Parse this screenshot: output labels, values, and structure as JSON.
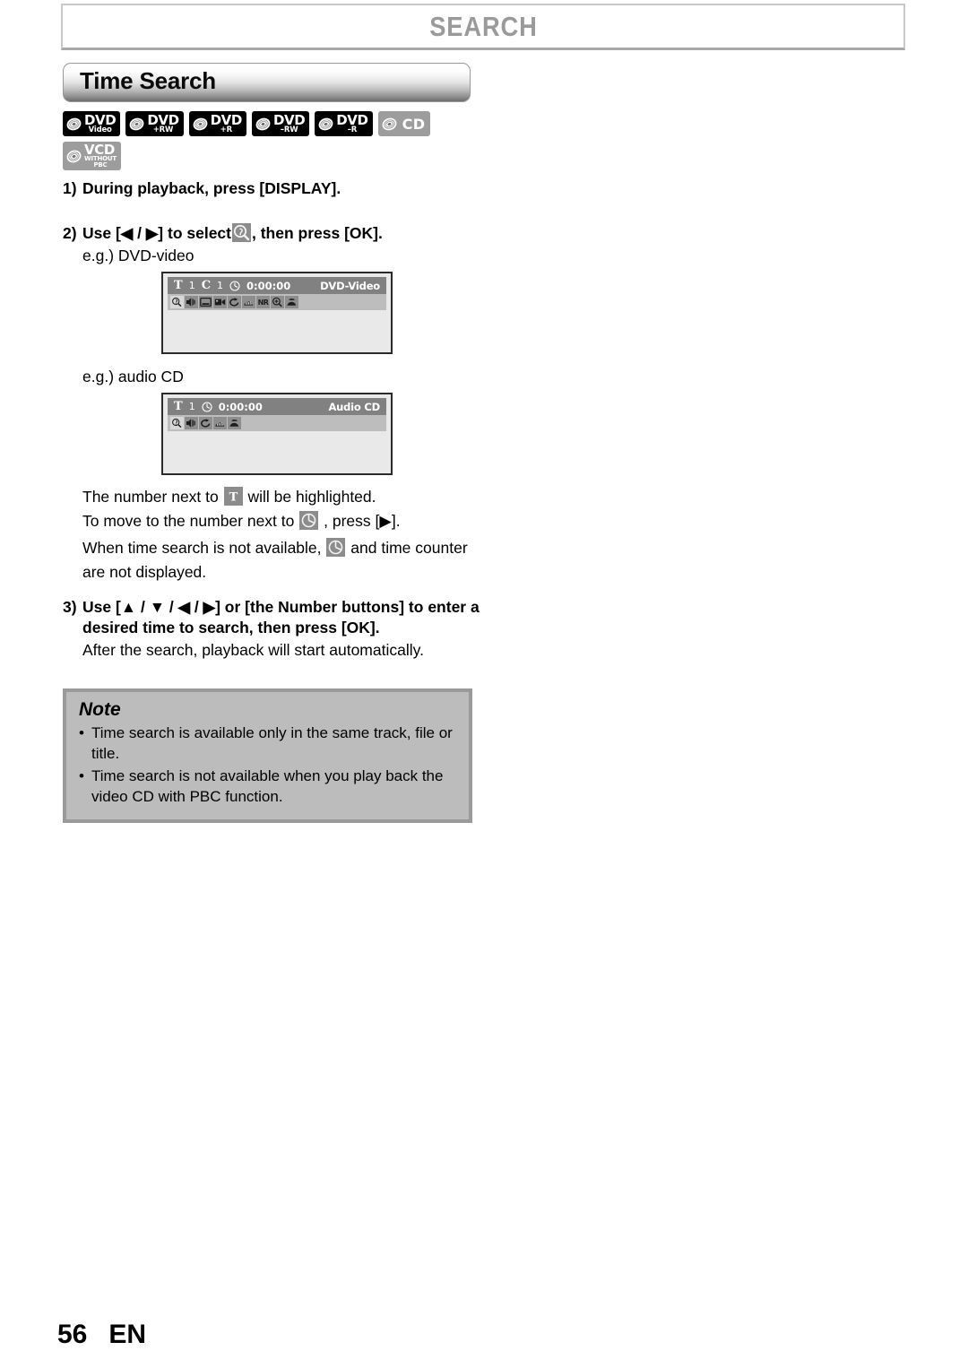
{
  "page_header": {
    "title": "SEARCH"
  },
  "section": {
    "title": "Time Search"
  },
  "badges": {
    "row1": [
      {
        "name": "dvd-video",
        "main": "DVD",
        "sub": "Video",
        "style": "dark"
      },
      {
        "name": "dvd-plus-rw",
        "main": "DVD",
        "sub": "+RW",
        "style": "dark"
      },
      {
        "name": "dvd-plus-r",
        "main": "DVD",
        "sub": "+R",
        "style": "dark"
      },
      {
        "name": "dvd-minus-rw",
        "main": "DVD",
        "sub": "–RW",
        "style": "dark"
      },
      {
        "name": "dvd-minus-r",
        "main": "DVD",
        "sub": "–R",
        "style": "dark"
      },
      {
        "name": "cd",
        "main": "CD",
        "sub": "",
        "style": "gray"
      }
    ],
    "row2": [
      {
        "name": "vcd-without-pbc",
        "main": "VCD",
        "sub": "WITHOUT",
        "sub2": "PBC",
        "style": "gray"
      }
    ]
  },
  "steps": {
    "step1": {
      "num": "1)",
      "text": "During playback, press [DISPLAY]."
    },
    "step2": {
      "num": "2)",
      "text_before": "Use [◀ / ▶] to select",
      "icon": "search-magnifier-icon",
      "text_after": ", then press [OK]."
    },
    "step2_example1_label": "e.g.) DVD-video",
    "step2_example2_label": "e.g.) audio CD",
    "step3": {
      "num": "3)",
      "line1": "Use [▲ / ▼ / ◀ / ▶] or [the Number buttons] to",
      "line2": "enter a desired time to search, then press [OK].",
      "sub": "After the search, playback will start automatically."
    }
  },
  "paragraphs": {
    "p1_before": "The number next to",
    "p1_icon": "title-t-icon",
    "p1_after": "will be highlighted.",
    "p2_before": "To move to the number next to",
    "p2_icon": "clock-icon",
    "p2_after": ", press [▶].",
    "p3_before": "When time search is not available,",
    "p3_icon": "clock-icon",
    "p3_after": "and time",
    "p3_line2": "counter are not displayed."
  },
  "osd_dvd": {
    "title_label": "T",
    "title_value": "1",
    "chapter_label": "C",
    "chapter_value": "1",
    "clock_icon": "clock-icon",
    "time": "0:00:00",
    "disc_type": "DVD-Video",
    "icons": [
      {
        "name": "search-icon",
        "text": "",
        "selected": true
      },
      {
        "name": "audio-icon",
        "text": "",
        "selected": false
      },
      {
        "name": "subtitle-icon",
        "text": "",
        "selected": false
      },
      {
        "name": "angle-icon",
        "text": "",
        "selected": false
      },
      {
        "name": "repeat-icon",
        "text": "",
        "selected": false
      },
      {
        "name": "surround-icon",
        "text": "",
        "selected": false
      },
      {
        "name": "noise-reduction-icon",
        "text": "NR",
        "selected": false
      },
      {
        "name": "zoom-icon",
        "text": "",
        "selected": false
      },
      {
        "name": "picture-adjust-icon",
        "text": "",
        "selected": false
      }
    ]
  },
  "osd_cd": {
    "title_label": "T",
    "title_value": "1",
    "clock_icon": "clock-icon",
    "time": "0:00:00",
    "disc_type": "Audio CD",
    "icons": [
      {
        "name": "search-icon",
        "text": "",
        "selected": true
      },
      {
        "name": "audio-icon",
        "text": "",
        "selected": false
      },
      {
        "name": "repeat-icon",
        "text": "",
        "selected": false
      },
      {
        "name": "surround-icon",
        "text": "",
        "selected": false
      },
      {
        "name": "picture-adjust-icon",
        "text": "",
        "selected": false
      }
    ]
  },
  "note": {
    "title": "Note",
    "bullet": "•",
    "items": [
      "Time search is available only in the same track, file or title.",
      "Time search is not available when you play back the video CD with PBC function."
    ]
  },
  "footer": {
    "page": "56",
    "lang": "EN"
  },
  "colors": {
    "header_text": "#9a9a9a",
    "osd_header_bg": "#818181",
    "osd_iconbar_bg": "#bdbdbd",
    "osd_body_bg": "#e9e9e9",
    "note_bg": "#bcbcbc",
    "note_border": "#9a9a9a"
  }
}
